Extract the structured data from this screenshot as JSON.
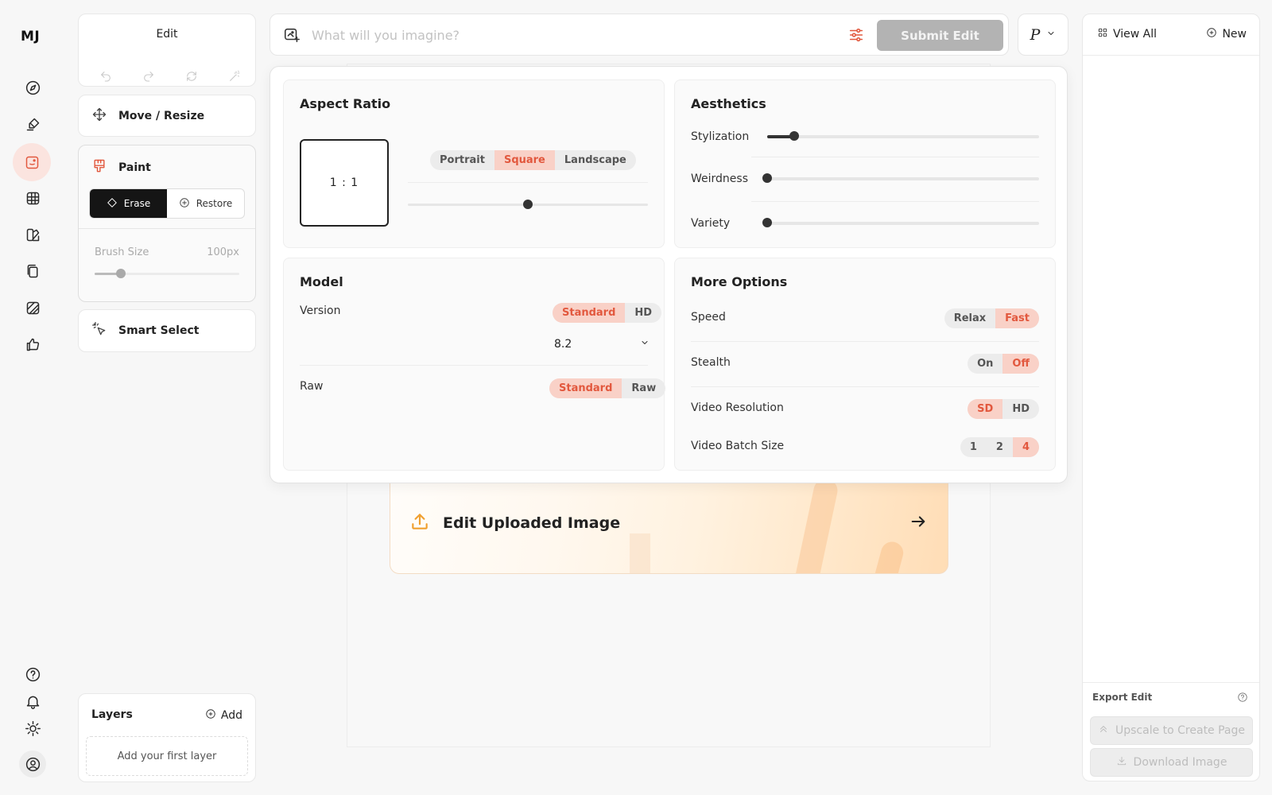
{
  "app": {
    "logo": "MJ"
  },
  "nav": {
    "items": [
      {
        "icon": "compass-icon",
        "active": false
      },
      {
        "icon": "brush-icon",
        "active": false
      },
      {
        "icon": "edit-frame-icon",
        "active": true
      },
      {
        "icon": "grid-globe-icon",
        "active": false
      },
      {
        "icon": "palette-icon",
        "active": false
      },
      {
        "icon": "pages-icon",
        "active": false
      },
      {
        "icon": "stripes-icon",
        "active": false
      },
      {
        "icon": "thumbs-up-icon",
        "active": false
      }
    ],
    "bottom": [
      "help-icon",
      "bell-icon",
      "sun-icon",
      "profile-icon"
    ]
  },
  "tools": {
    "edit_title": "Edit",
    "move_resize": "Move / Resize",
    "paint": {
      "label": "Paint",
      "erase": "Erase",
      "restore": "Restore",
      "selected": "Erase",
      "brush_label": "Brush Size",
      "brush_value": "100px",
      "brush_level": 0.18
    },
    "smart_select": "Smart Select",
    "layers": {
      "title": "Layers",
      "add": "Add",
      "empty": "Add your first layer"
    }
  },
  "prompt": {
    "placeholder": "What will you imagine?",
    "value": "",
    "submit": "Submit Edit",
    "personalize": "P"
  },
  "settings": {
    "aspect_ratio": {
      "title": "Aspect Ratio",
      "ratio": "1 : 1",
      "options": [
        "Portrait",
        "Square",
        "Landscape"
      ],
      "selected": "Square",
      "slider_level": 0.5
    },
    "aesthetics": {
      "title": "Aesthetics",
      "sliders": [
        {
          "label": "Stylization",
          "level": 0.1
        },
        {
          "label": "Weirdness",
          "level": 0
        },
        {
          "label": "Variety",
          "level": 0
        }
      ]
    },
    "model": {
      "title": "Model",
      "version_label": "Version",
      "version_modes": [
        "Standard",
        "HD"
      ],
      "version_mode_selected": "Standard",
      "version_value": "8.2",
      "raw_label": "Raw",
      "raw_modes": [
        "Standard",
        "Raw"
      ],
      "raw_selected": "Standard"
    },
    "more": {
      "title": "More Options",
      "rows": [
        {
          "label": "Speed",
          "options": [
            "Relax",
            "Fast"
          ],
          "selected": "Fast"
        },
        {
          "label": "Stealth",
          "options": [
            "On",
            "Off"
          ],
          "selected": "Off"
        },
        {
          "label": "Video Resolution",
          "options": [
            "SD",
            "HD"
          ],
          "selected": "SD"
        },
        {
          "label": "Video Batch Size",
          "options": [
            "1",
            "2",
            "4"
          ],
          "selected": "4"
        }
      ]
    }
  },
  "canvas": {
    "upload_label": "Edit Uploaded Image"
  },
  "right_panel": {
    "view_all": "View All",
    "new": "New",
    "export_label": "Export Edit",
    "upscale": "Upscale to Create Page",
    "download": "Download Image"
  },
  "colors": {
    "accent": "#e2583e",
    "accent_soft": "#f9d1c7",
    "disabled": "#b3b3b3"
  }
}
